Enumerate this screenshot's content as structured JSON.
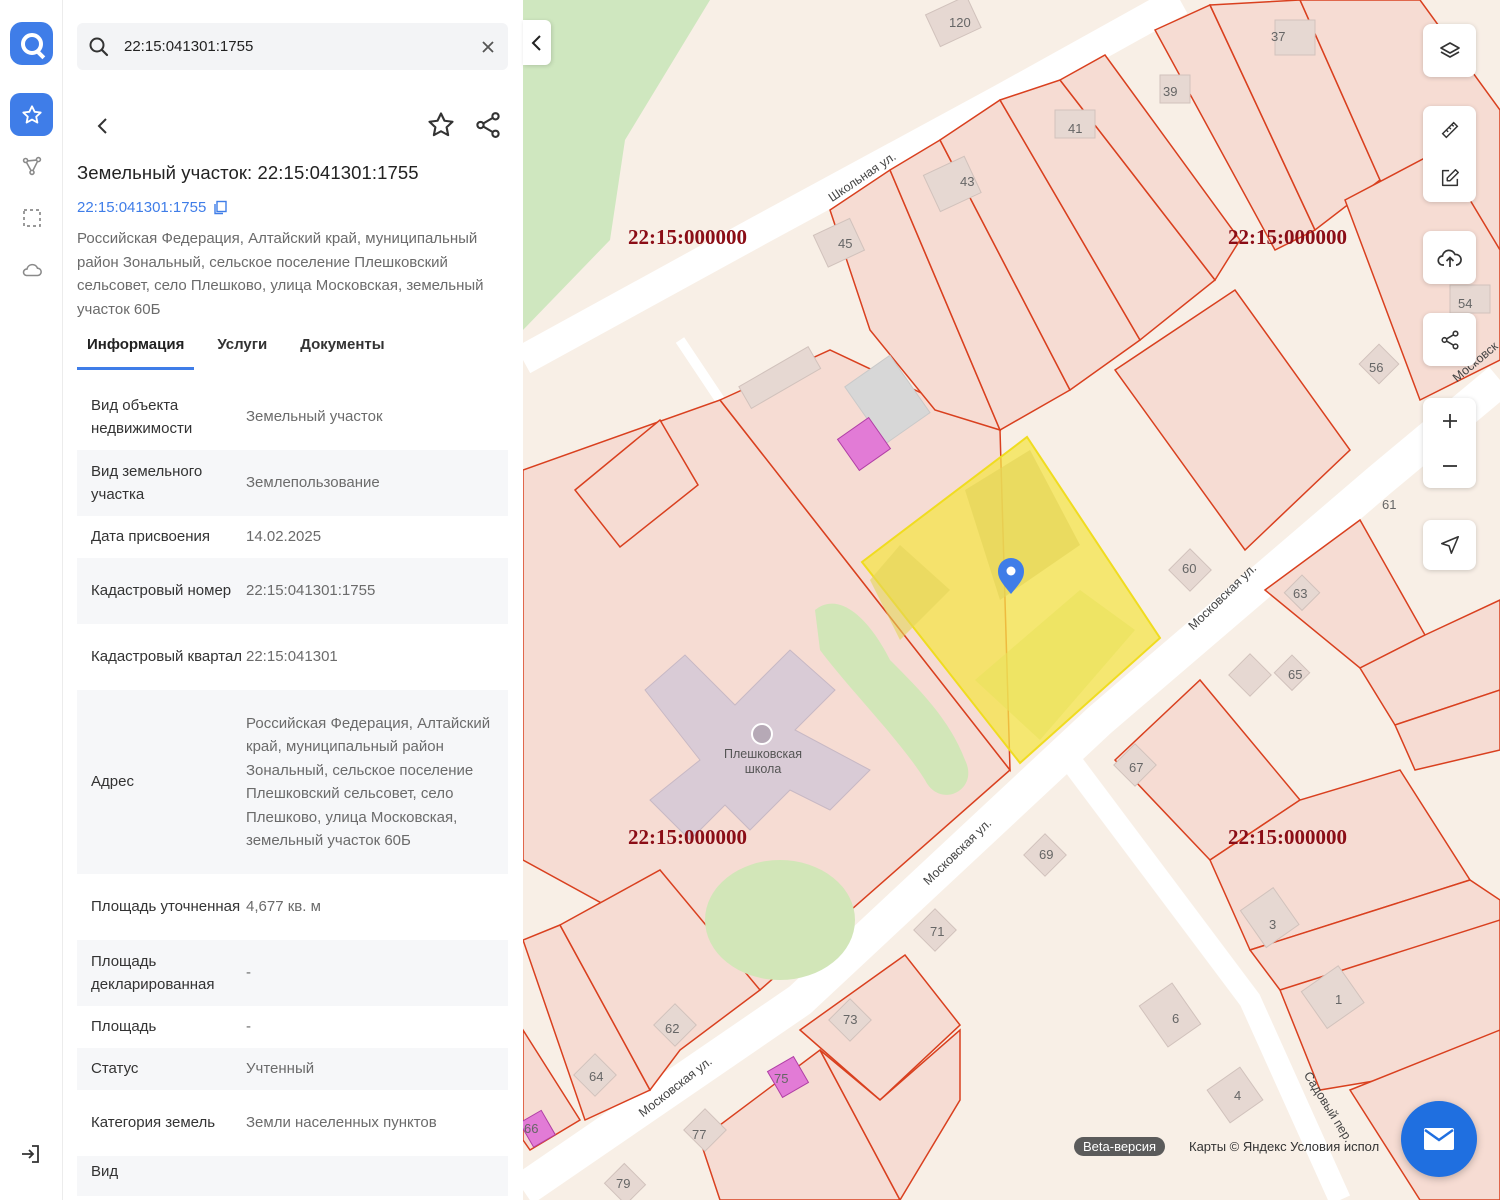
{
  "search": {
    "value": "22:15:041301:1755"
  },
  "panel": {
    "title": "Земельный участок: 22:15:041301:1755",
    "cadastral_link": "22:15:041301:1755",
    "address": "Российская Федерация, Алтайский край, муниципальный район Зональный, сельское поселение Плешковский сельсовет, село Плешково, улица Московская, земельный участок 60Б",
    "tabs": [
      {
        "label": "Информация"
      },
      {
        "label": "Услуги"
      },
      {
        "label": "Документы"
      }
    ],
    "rows": [
      {
        "key": "Вид объекта недвижимости",
        "value": "Земельный участок"
      },
      {
        "key": "Вид земельного участка",
        "value": "Землепользование"
      },
      {
        "key": "Дата присвоения",
        "value": "14.02.2025"
      },
      {
        "key": "Кадастровый номер",
        "value": "22:15:041301:1755"
      },
      {
        "key": "Кадастровый квартал",
        "value": "22:15:041301"
      },
      {
        "key": "Адрес",
        "value": "Российская Федерация, Алтайский край, муниципальный район Зональный, сельское поселение Плешковский сельсовет, село Плешково, улица Московская, земельный участок 60Б"
      },
      {
        "key": "Площадь уточненная",
        "value": "4,677 кв. м"
      },
      {
        "key": "Площадь декларированная",
        "value": "-"
      },
      {
        "key": "Площадь",
        "value": "-"
      },
      {
        "key": "Статус",
        "value": "Учтенный"
      },
      {
        "key": "Категория земель",
        "value": "Земли населенных пунктов"
      },
      {
        "key": "Вид",
        "value": ""
      }
    ]
  },
  "map": {
    "zone_labels": [
      "22:15:000000",
      "22:15:000000",
      "22:15:000000",
      "22:15:000000"
    ],
    "streets": [
      "Школьная ул.",
      "Московская ул.",
      "Московская ул.",
      "Московская ул.",
      "Садовый пер.",
      "Московск"
    ],
    "house_numbers": [
      "120",
      "39",
      "37",
      "41",
      "43",
      "45",
      "54",
      "56",
      "61",
      "60",
      "63",
      "65",
      "67",
      "69",
      "71",
      "73",
      "75",
      "77",
      "79",
      "62",
      "64",
      "66",
      "3",
      "1",
      "6",
      "4"
    ],
    "poi": "Плешковская школа",
    "beta_label": "Beta-версия",
    "attribution": "Карты © Яндекс   Условия испол",
    "colors": {
      "parcel_fill": "#f6dcd3",
      "parcel_stroke": "#d9401f",
      "selected": "#f7e64a",
      "pink": "#e27bd6"
    }
  }
}
